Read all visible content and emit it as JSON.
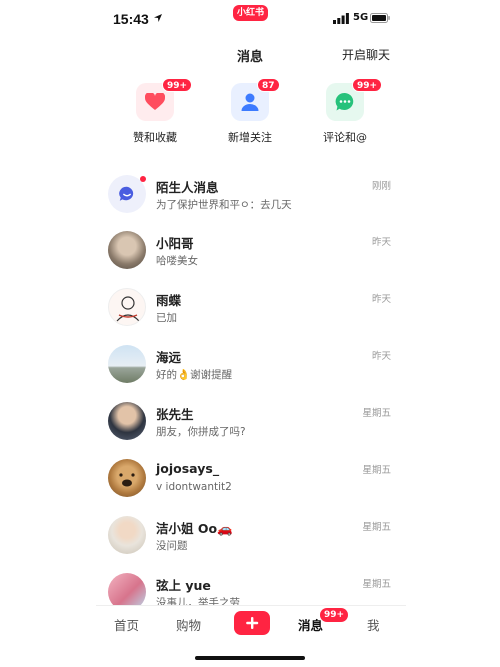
{
  "status_bar": {
    "time": "15:43",
    "app_pill": "小红书",
    "network": "5G"
  },
  "header": {
    "title": "消息",
    "action": "开启聊天"
  },
  "categories": [
    {
      "label": "赞和收藏",
      "badge": "99+",
      "icon": "heart-icon",
      "color": "#ff4d5e",
      "bg": "#ffecee"
    },
    {
      "label": "新增关注",
      "badge": "87",
      "icon": "person-icon",
      "color": "#3d7bff",
      "bg": "#e9f0ff"
    },
    {
      "label": "评论和@",
      "badge": "99+",
      "icon": "chat-bubble-icon",
      "color": "#27c27b",
      "bg": "#e6f8ef"
    }
  ],
  "conversations": [
    {
      "name": "陌生人消息",
      "preview": "为了保护世界和平ㅇ：去几天",
      "time": "刚刚",
      "avatar": "stranger-message-icon"
    },
    {
      "name": "小阳哥",
      "preview": "哈喽美女",
      "time": "昨天",
      "avatar": "avatar-photo"
    },
    {
      "name": "雨蝶",
      "preview": "已加",
      "time": "昨天",
      "avatar": "avatar-sketch"
    },
    {
      "name": "海远",
      "preview": "好的👌谢谢提醒",
      "time": "昨天",
      "avatar": "avatar-landscape"
    },
    {
      "name": "张先生",
      "preview": "朋友，你拼成了吗?",
      "time": "星期五",
      "avatar": "avatar-photo"
    },
    {
      "name": "jojosays_",
      "preview": "v  idontwantit2",
      "time": "星期五",
      "avatar": "avatar-dog"
    },
    {
      "name": "洁小姐 Oo🚗",
      "preview": "没问题",
      "time": "星期五",
      "avatar": "avatar-photo"
    },
    {
      "name": "弦上 yue",
      "preview": "没事儿，举手之劳",
      "time": "星期五",
      "avatar": "avatar-pink"
    }
  ],
  "tabbar": {
    "home": "首页",
    "shop": "购物",
    "messages": "消息",
    "messages_badge": "99+",
    "me": "我"
  },
  "colors": {
    "brand": "#ff2442",
    "unread_dot": "#ff2442",
    "muted_text": "#999999"
  }
}
